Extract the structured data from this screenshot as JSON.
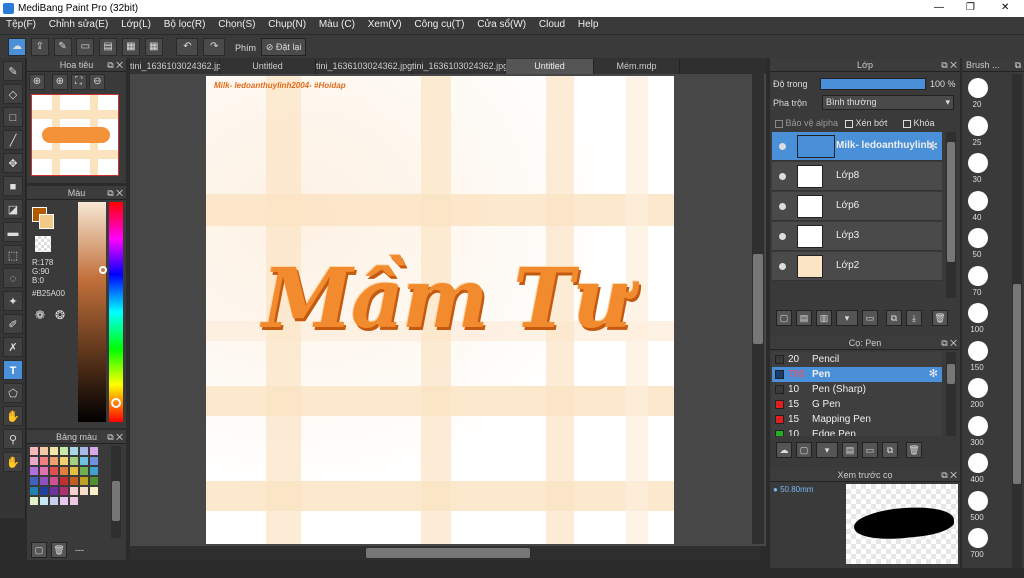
{
  "titlebar": {
    "title": "MediBang Paint Pro (32bit)",
    "min": "—",
    "max": "❐",
    "close": "✕"
  },
  "menu": [
    "Tệp(F)",
    "Chỉnh sửa(E)",
    "Lớp(L)",
    "Bộ lọc(R)",
    "Chọn(S)",
    "Chụp(N)",
    "Màu (C)",
    "Xem(V)",
    "Công cụ(T)",
    "Cửa sổ(W)",
    "Cloud",
    "Help"
  ],
  "toolbar": {
    "phim_label": "Phím",
    "reset_label": "Đặt lại"
  },
  "navigator": {
    "title": "Hoa tiêu"
  },
  "color_panel": {
    "title": "Màu",
    "r": "R:178",
    "g": "G:90",
    "b": "B:0",
    "hex": "#B25A00",
    "main_color": "#B25A00",
    "sub_color": "#f3c98a"
  },
  "palette": {
    "title": "Bảng màu",
    "footer": "---"
  },
  "tabs": [
    "tini_1636103024362.jpg",
    "Untitled",
    "tini_1636103024362.jpg",
    "tini_1636103024362.jpg",
    "Untitled",
    "Mém.mdp"
  ],
  "canvas": {
    "header_text": "Milk- ledoanthuylinh2004- #Hoidap",
    "art_text": "Mầm Tư"
  },
  "layer_panel": {
    "title": "Lớp",
    "opacity_label": "Độ trong",
    "opacity_value": "100 %",
    "blend_label": "Pha trộn",
    "blend_value": "Bình thường",
    "protect_alpha": "Bảo vệ alpha",
    "clipping": "Xén bớt",
    "lock": "Khóa",
    "layers": [
      {
        "name": "Milk- ledoanthuylinh"
      },
      {
        "name": "Lớp8"
      },
      {
        "name": "Lớp6"
      },
      {
        "name": "Lớp3"
      },
      {
        "name": "Lớp2"
      }
    ]
  },
  "pen_panel": {
    "title": "Cọ: Pen",
    "brushes": [
      {
        "size": "20",
        "name": "Pencil",
        "color": "#3a3a3a"
      },
      {
        "size": "700",
        "name": "Pen",
        "color": "#1a3d6a"
      },
      {
        "size": "10",
        "name": "Pen (Sharp)",
        "color": "#3a3a3a"
      },
      {
        "size": "15",
        "name": "G Pen",
        "color": "#e02020"
      },
      {
        "size": "15",
        "name": "Mapping Pen",
        "color": "#e02020"
      },
      {
        "size": "10",
        "name": "Edge Pen",
        "color": "#20b020"
      }
    ]
  },
  "preview_panel": {
    "title": "Xem trước cọ",
    "size": "50.80mm"
  },
  "brush_size_panel": {
    "title": "Brush ...",
    "sizes": [
      "20",
      "25",
      "30",
      "40",
      "50",
      "70",
      "100",
      "150",
      "200",
      "300",
      "400",
      "500",
      "700"
    ]
  },
  "palette_colors": [
    "#f6b8b8",
    "#f6c9a8",
    "#f4e7a8",
    "#c8e8a8",
    "#a8d8e8",
    "#a8b8e8",
    "#d8a8e8",
    "#e8a8c8",
    "#f08080",
    "#f0a070",
    "#f0d070",
    "#a0d080",
    "#70c0e0",
    "#7090e0",
    "#b070e0",
    "#e070b0",
    "#e05050",
    "#e08040",
    "#e0c040",
    "#70b050",
    "#40a0d0",
    "#4060c0",
    "#9050c0",
    "#d05090",
    "#c03030",
    "#c06020",
    "#c0a020",
    "#509030",
    "#2080b0",
    "#2040a0",
    "#7030a0",
    "#b03070",
    "#f8d0d0",
    "#f8e0c8",
    "#f8f0c8",
    "#e0f0c8",
    "#c8e8f0",
    "#c8d0f0",
    "#e8c8f0",
    "#f0c8e0"
  ]
}
